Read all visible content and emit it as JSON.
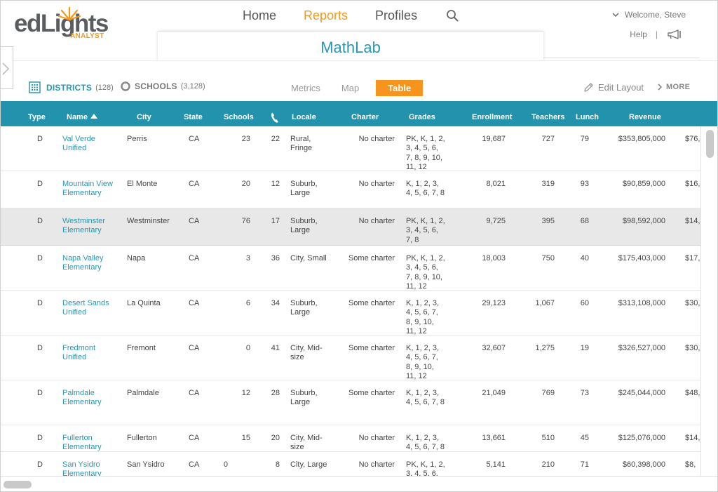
{
  "brand": {
    "word": "edLights",
    "sub": "ANALYST"
  },
  "nav": {
    "home": "Home",
    "reports": "Reports",
    "profiles": "Profiles"
  },
  "user": {
    "welcome": "Welcome, Steve",
    "help": "Help",
    "separator": "|"
  },
  "project": {
    "title": "MathLab"
  },
  "toolbar": {
    "districts_label": "DISTRICTS",
    "districts_count": "(128)",
    "schools_label": "SCHOOLS",
    "schools_count": "(3,128)",
    "view_metrics": "Metrics",
    "view_map": "Map",
    "view_table": "Table",
    "edit_layout": "Edit Layout",
    "more": "MORE"
  },
  "colors": {
    "accent": "#2393ad",
    "highlight": "#f7941d",
    "link": "#2a97b0"
  },
  "table": {
    "headers": {
      "type": "Type",
      "name": "Name",
      "city": "City",
      "state": "State",
      "schools": "Schools",
      "locale": "Locale",
      "charter": "Charter",
      "grades": "Grades",
      "enrollment": "Enrollment",
      "teachers": "Teachers",
      "lunch": "Lunch",
      "revenue": "Revenue"
    },
    "rows": [
      {
        "type": "D",
        "name": [
          "Val Verde",
          "Unified"
        ],
        "city": "Perris",
        "state": "CA",
        "schools": "23",
        "phone": "22",
        "locale": [
          "Rural,",
          "Fringe"
        ],
        "charter": "No charter",
        "grades": [
          "PK, K, 1, 2,",
          "3, 4, 5, 6,",
          "7, 8, 9, 10,",
          "11, 12"
        ],
        "enrollment": "19,687",
        "teachers": "727",
        "lunch": "79",
        "revenue": "$353,805,000",
        "extra": "$76,",
        "selected": false
      },
      {
        "type": "D",
        "name": [
          "Mountain View",
          "Elementary"
        ],
        "city": "El Monte",
        "state": "CA",
        "schools": "20",
        "phone": "12",
        "locale": [
          "Suburb,",
          "Large"
        ],
        "charter": "No charter",
        "grades": [
          "K, 1, 2, 3,",
          "4, 5, 6, 7, 8"
        ],
        "enrollment": "8,021",
        "teachers": "319",
        "lunch": "93",
        "revenue": "$90,859,000",
        "extra": "$16,",
        "selected": false
      },
      {
        "type": "D",
        "name": [
          "Westminster",
          "Elementary"
        ],
        "city": "Westminster",
        "state": "CA",
        "schools": "76",
        "phone": "17",
        "locale": [
          "Suburb,",
          "Large"
        ],
        "charter": "No charter",
        "grades": [
          "PK, K, 1, 2,",
          "3, 4, 5, 6,",
          "7, 8"
        ],
        "enrollment": "9,725",
        "teachers": "395",
        "lunch": "68",
        "revenue": "$98,592,000",
        "extra": "$14,",
        "selected": true
      },
      {
        "type": "D",
        "name": [
          "Napa Valley",
          "Elementary"
        ],
        "city": "Napa",
        "state": "CA",
        "schools": "3",
        "phone": "36",
        "locale": [
          "City, Small"
        ],
        "charter": "Some charter",
        "grades": [
          "PK, K, 1, 2,",
          "3, 4, 5, 6,",
          "7, 8, 9, 10,",
          "11, 12"
        ],
        "enrollment": "18,003",
        "teachers": "750",
        "lunch": "40",
        "revenue": "$175,403,000",
        "extra": "$17,",
        "selected": false
      },
      {
        "type": "D",
        "name": [
          "Desert Sands",
          "Unified"
        ],
        "city": "La Quinta",
        "state": "CA",
        "schools": "6",
        "phone": "34",
        "locale": [
          "Suburb,",
          "Large"
        ],
        "charter": "Some charter",
        "grades": [
          "K, 1, 2, 3,",
          "4, 5, 6, 7,",
          "8, 9, 10,",
          "11, 12"
        ],
        "enrollment": "29,123",
        "teachers": "1,067",
        "lunch": "60",
        "revenue": "$313,108,000",
        "extra": "$30,",
        "selected": false
      },
      {
        "type": "D",
        "name": [
          "Fredmont",
          "Unified"
        ],
        "city": "Fremont",
        "state": "CA",
        "schools": "0",
        "phone": "41",
        "locale": [
          "City, Mid-",
          "size"
        ],
        "charter": "Some charter",
        "grades": [
          "K, 1, 2, 3,",
          "4, 5, 6, 7,",
          "8, 9, 10,",
          "11, 12"
        ],
        "enrollment": "32,607",
        "teachers": "1,275",
        "lunch": "19",
        "revenue": "$326,527,000",
        "extra": "$30,",
        "selected": false
      },
      {
        "type": "D",
        "name": [
          "Palmdale",
          "Elementary"
        ],
        "city": "Palmdale",
        "state": "CA",
        "schools": "12",
        "phone": "28",
        "locale": [
          "Suburb,",
          "Large"
        ],
        "charter": "Some charter",
        "grades": [
          "K, 1, 2, 3,",
          "4, 5, 6, 7, 8"
        ],
        "enrollment": "21,049",
        "teachers": "769",
        "lunch": "73",
        "revenue": "$245,044,000",
        "extra": "$48,",
        "selected": false
      },
      {
        "type": "D",
        "name": [
          "Fullerton",
          "Elementary"
        ],
        "city": "Fullerton",
        "state": "CA",
        "schools": "15",
        "phone": "20",
        "locale": [
          "City, Mid-",
          "size"
        ],
        "charter": "No charter",
        "grades": [
          "K, 1, 2, 3,",
          "4, 5, 6, 7, 8"
        ],
        "enrollment": "13,661",
        "teachers": "510",
        "lunch": "45",
        "revenue": "$125,076,000",
        "extra": "$14,",
        "selected": false
      },
      {
        "type": "D",
        "name": [
          "San Ysidro",
          "Elementary"
        ],
        "city": "San Ysidro",
        "state": "CA",
        "schools": "0",
        "phone": "8",
        "locale": [
          "City, Large"
        ],
        "charter": "No charter",
        "grades": [
          "PK, K, 1, 2,",
          "3, 4, 5, 6,"
        ],
        "enrollment": "5,141",
        "teachers": "210",
        "lunch": "71",
        "revenue": "$60,398,000",
        "extra": "$8,",
        "selected": false
      }
    ]
  }
}
